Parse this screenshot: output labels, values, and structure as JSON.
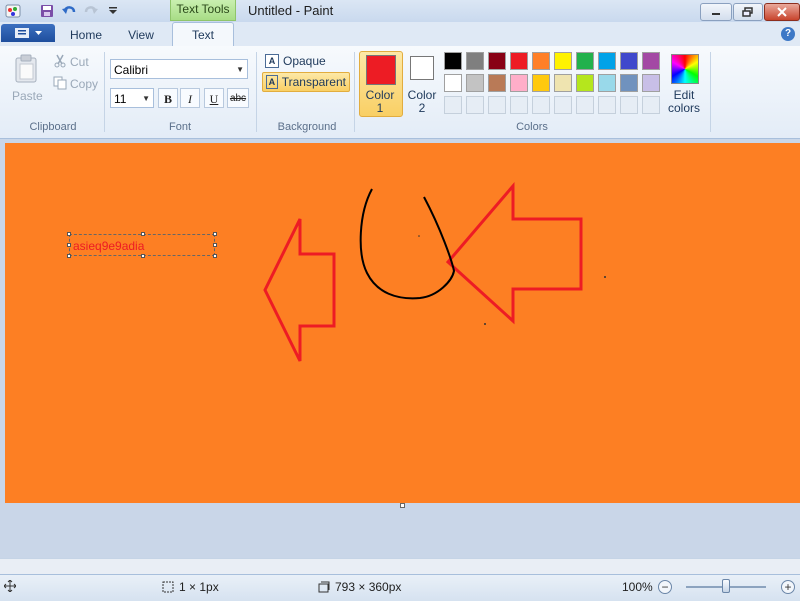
{
  "window": {
    "title": "Untitled - Paint",
    "context_tab": "Text Tools"
  },
  "tabs": {
    "home": "Home",
    "view": "View",
    "text": "Text"
  },
  "help": "?",
  "clipboard": {
    "paste": "Paste",
    "cut": "Cut",
    "copy": "Copy",
    "group": "Clipboard"
  },
  "font": {
    "name": "Calibri",
    "size": "11",
    "bold": "B",
    "italic": "I",
    "underline": "U",
    "strike": "abc",
    "group": "Font"
  },
  "background": {
    "opaque": "Opaque",
    "transparent": "Transparent",
    "group": "Background",
    "icon_letter": "A"
  },
  "colors": {
    "color1_label": "Color\n1",
    "color2_label": "Color\n2",
    "edit_label": "Edit\ncolors",
    "group": "Colors",
    "color1_value": "#ed1c24",
    "color2_value": "#ffffff",
    "palette_row1": [
      "#000000",
      "#7f7f7f",
      "#880015",
      "#ed1c24",
      "#ff7f27",
      "#fff200",
      "#22b14c",
      "#00a2e8",
      "#3f48cc",
      "#a349a4"
    ],
    "palette_row2": [
      "#ffffff",
      "#c3c3c3",
      "#b97a57",
      "#ffaec9",
      "#ffc90e",
      "#efe4b0",
      "#b5e61d",
      "#99d9ea",
      "#7092be",
      "#c8bfe7"
    ]
  },
  "canvas": {
    "background": "#fd7f23",
    "text_content": "asieq9e9adia",
    "text_color": "#ed1c24"
  },
  "status": {
    "cursor_size": "1 × 1px",
    "canvas_size": "793 × 360px",
    "zoom": "100%"
  }
}
